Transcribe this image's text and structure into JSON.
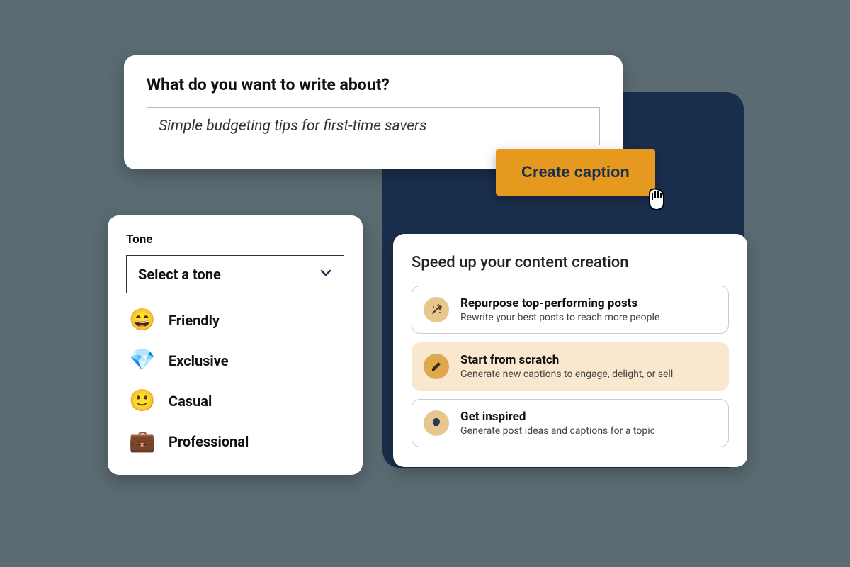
{
  "prompt": {
    "title": "What do you want to write about?",
    "value": "Simple budgeting tips for first-time savers"
  },
  "create_button": "Create caption",
  "tone": {
    "label": "Tone",
    "placeholder": "Select a tone",
    "options": [
      {
        "emoji": "😄",
        "name": "Friendly"
      },
      {
        "emoji": "💎",
        "name": "Exclusive"
      },
      {
        "emoji": "🙂",
        "name": "Casual"
      },
      {
        "emoji": "💼",
        "name": "Professional"
      }
    ]
  },
  "speed": {
    "title": "Speed up your content creation",
    "options": [
      {
        "icon": "wand",
        "title": "Repurpose top-performing posts",
        "subtitle": "Rewrite your best posts to reach more people",
        "active": false
      },
      {
        "icon": "pencil",
        "title": "Start from scratch",
        "subtitle": "Generate new captions to engage, delight, or sell",
        "active": true
      },
      {
        "icon": "bulb",
        "title": "Get inspired",
        "subtitle": "Generate post ideas and captions for a topic",
        "active": false
      }
    ]
  }
}
